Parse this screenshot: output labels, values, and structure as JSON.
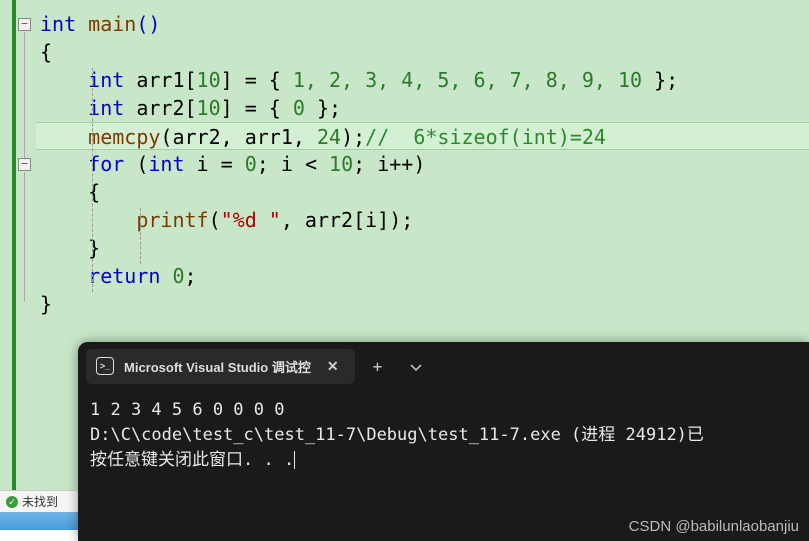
{
  "code": {
    "line1_kw": "int",
    "line1_fn": " main",
    "line1_rest": "()",
    "line2": "{",
    "line3_indent": "    ",
    "line3_kw": "int",
    "line3_var": " arr1[",
    "line3_n1": "10",
    "line3_mid": "] = { ",
    "line3_vals": "1, 2, 3, 4, 5, 6, 7, 8, 9, 10",
    "line3_end": " };",
    "line4_indent": "    ",
    "line4_kw": "int",
    "line4_var": " arr2[",
    "line4_n1": "10",
    "line4_mid": "] = { ",
    "line4_vals": "0",
    "line4_end": " };",
    "line5_indent": "    ",
    "line5_fn": "memcpy",
    "line5_args": "(arr2, arr1, ",
    "line5_num": "24",
    "line5_close": ");",
    "line5_cmt": "//  6*sizeof(int)=24",
    "line6_indent": "    ",
    "line6_for": "for",
    "line6_open": " (",
    "line6_int": "int",
    "line6_init": " i = ",
    "line6_zero": "0",
    "line6_cond": "; i < ",
    "line6_ten": "10",
    "line6_inc": "; i++)",
    "line7": "    {",
    "line8_indent": "        ",
    "line8_fn": "printf",
    "line8_open": "(",
    "line8_str": "\"%d \"",
    "line8_rest": ", arr2[i]);",
    "line9": "    }",
    "line10_indent": "    ",
    "line10_kw": "return",
    "line10_val": " 0",
    "line10_end": ";",
    "line11": "}"
  },
  "terminal": {
    "tab_title": "Microsoft Visual Studio 调试控",
    "output_line1": "1 2 3 4 5 6 0 0 0 0",
    "output_line2": "D:\\C\\code\\test_c\\test_11-7\\Debug\\test_11-7.exe (进程 24912)已",
    "output_line3": "按任意键关闭此窗口. . ."
  },
  "status": {
    "text": "未找到"
  },
  "watermark": "CSDN @babilunlaobanjiu"
}
